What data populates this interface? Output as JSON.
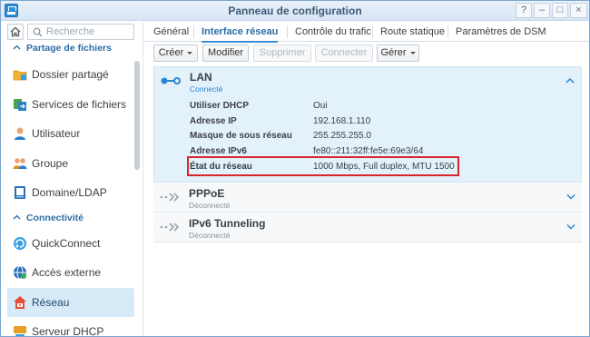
{
  "window": {
    "title": "Panneau de configuration",
    "controls": {
      "help": "?",
      "minimize": "–",
      "maximize": "□",
      "close": "×"
    }
  },
  "sidebar": {
    "search_placeholder": "Recherche",
    "sections": [
      {
        "label": "Partage de fichiers"
      },
      {
        "label": "Connectivité"
      }
    ],
    "items": [
      {
        "label": "Dossier partagé",
        "icon": "shared-folder-icon"
      },
      {
        "label": "Services de fichiers",
        "icon": "file-services-icon"
      },
      {
        "label": "Utilisateur",
        "icon": "user-icon"
      },
      {
        "label": "Groupe",
        "icon": "group-icon"
      },
      {
        "label": "Domaine/LDAP",
        "icon": "domain-icon"
      },
      {
        "label": "QuickConnect",
        "icon": "quickconnect-icon"
      },
      {
        "label": "Accès externe",
        "icon": "external-access-icon"
      },
      {
        "label": "Réseau",
        "icon": "network-icon",
        "active": true
      },
      {
        "label": "Serveur DHCP",
        "icon": "dhcp-icon"
      }
    ]
  },
  "tabs": [
    {
      "label": "Général"
    },
    {
      "label": "Interface réseau",
      "active": true
    },
    {
      "label": "Contrôle du trafic"
    },
    {
      "label": "Route statique"
    },
    {
      "label": "Paramètres de DSM"
    }
  ],
  "toolbar": {
    "create": "Créer",
    "modify": "Modifier",
    "delete": "Supprimer",
    "connect": "Connecter",
    "manage": "Gérer"
  },
  "interfaces": {
    "lan": {
      "name": "LAN",
      "status": "Connecté",
      "details": [
        {
          "key": "Utiliser DHCP",
          "value": "Oui"
        },
        {
          "key": "Adresse IP",
          "value": "192.168.1.110"
        },
        {
          "key": "Masque de sous réseau",
          "value": "255.255.255.0"
        },
        {
          "key": "Adresse IPv6",
          "value": "fe80::211:32ff:fe5e:69e3/64"
        },
        {
          "key": "État du réseau",
          "value": "1000 Mbps, Full duplex, MTU 1500"
        }
      ]
    },
    "pppoe": {
      "name": "PPPoE",
      "status": "Déconnecté"
    },
    "ipv6": {
      "name": "IPv6 Tunneling",
      "status": "Déconnecté"
    }
  },
  "colors": {
    "accent": "#2a86d0",
    "active_bg": "#d7eaf8",
    "lan_bg": "#e3f1fb",
    "highlight": "#d9242b"
  }
}
